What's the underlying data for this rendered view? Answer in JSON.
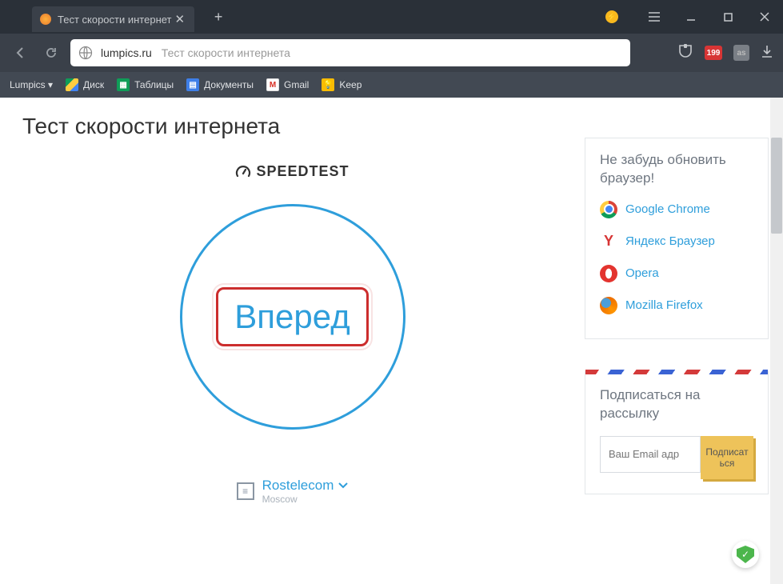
{
  "titlebar": {
    "tab_title": "Тест скорости интернет",
    "close": "✕",
    "newtab": "+"
  },
  "addr": {
    "host": "lumpics.ru",
    "rest": "Тест скорости интернета",
    "badge_count": "199",
    "gray_badge": "as"
  },
  "bookmarks": {
    "lumpics": "Lumpics ▾",
    "drive": "Диск",
    "sheets": "Таблицы",
    "docs": "Документы",
    "gmail": "Gmail",
    "keep": "Keep"
  },
  "page": {
    "title": "Тест скорости интернета",
    "brand": "SPEEDTEST",
    "go": "Вперед",
    "isp_name": "Rostelecom",
    "isp_city": "Moscow"
  },
  "sidebar": {
    "update_title": "Не забудь обновить браузер!",
    "browsers": {
      "chrome": "Google Chrome",
      "yandex": "Яндекс Браузер",
      "opera": "Opera",
      "firefox": "Mozilla Firefox"
    },
    "sub_title": "Подписаться на рассылку",
    "sub_placeholder": "Ваш Email адр",
    "sub_btn": "Подписаться"
  }
}
